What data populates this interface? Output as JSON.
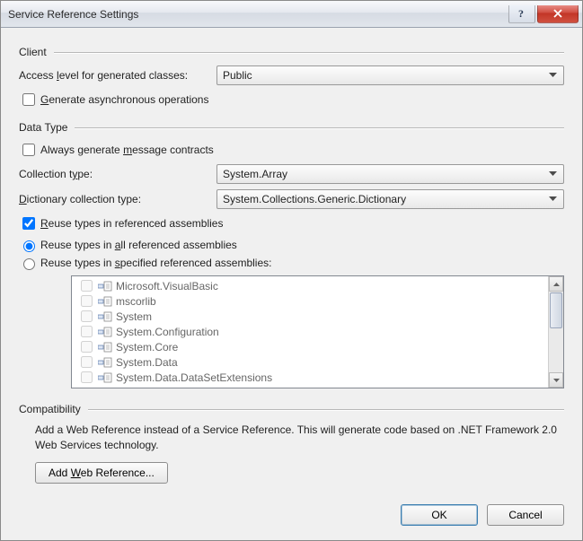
{
  "title": "Service Reference Settings",
  "sections": {
    "client": "Client",
    "datatype": "Data Type",
    "compat": "Compatibility"
  },
  "client": {
    "access_label_pre": "Access ",
    "access_label_u": "l",
    "access_label_post": "evel for generated classes:",
    "access_value": "Public",
    "gen_async_u": "G",
    "gen_async_post": "enerate asynchronous operations"
  },
  "datatype": {
    "always_pre": "Always generate ",
    "always_u": "m",
    "always_post": "essage contracts",
    "coll_pre": "Collection t",
    "coll_u": "y",
    "coll_post": "pe:",
    "coll_value": "System.Array",
    "dict_u": "D",
    "dict_post": "ictionary collection type:",
    "dict_value": "System.Collections.Generic.Dictionary",
    "reuse_u": "R",
    "reuse_post": "euse types in referenced assemblies",
    "reuse_all_pre": "Reuse types in ",
    "reuse_all_u": "a",
    "reuse_all_post": "ll referenced assemblies",
    "reuse_spec_pre": "Reuse types in ",
    "reuse_spec_u": "s",
    "reuse_spec_post": "pecified referenced assemblies:",
    "assemblies": [
      "Microsoft.VisualBasic",
      "mscorlib",
      "System",
      "System.Configuration",
      "System.Core",
      "System.Data",
      "System.Data.DataSetExtensions"
    ]
  },
  "compat": {
    "text": "Add a Web Reference instead of a Service Reference. This will generate code based on .NET Framework 2.0 Web Services technology.",
    "btn_pre": "Add ",
    "btn_u": "W",
    "btn_post": "eb Reference..."
  },
  "buttons": {
    "ok": "OK",
    "cancel": "Cancel"
  }
}
